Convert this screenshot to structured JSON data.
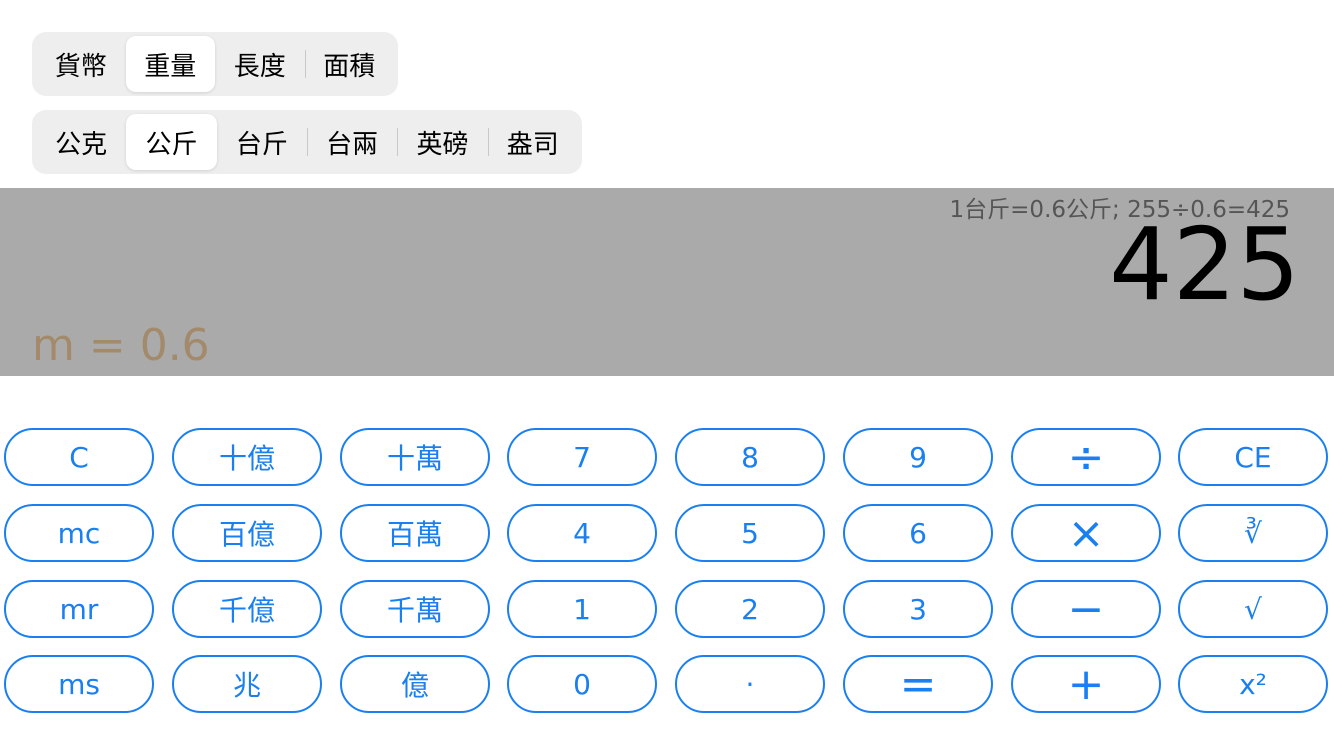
{
  "category_tabs": [
    {
      "label": "貨幣",
      "active": false
    },
    {
      "label": "重量",
      "active": true
    },
    {
      "label": "長度",
      "active": false
    },
    {
      "label": "面積",
      "active": false
    }
  ],
  "unit_tabs": [
    {
      "label": "公克",
      "active": false
    },
    {
      "label": "公斤",
      "active": true
    },
    {
      "label": "台斤",
      "active": false
    },
    {
      "label": "台兩",
      "active": false
    },
    {
      "label": "英磅",
      "active": false
    },
    {
      "label": "盎司",
      "active": false
    }
  ],
  "display": {
    "formula": "1台斤=0.6公斤; 255÷0.6=425",
    "result": "425",
    "memory": "m = 0.6"
  },
  "colors": {
    "accent": "#1a7ff0",
    "display_bg": "#aaaaaa",
    "memory_text": "#a38a6a"
  },
  "keys": [
    [
      "C",
      "十億",
      "十萬",
      "7",
      "8",
      "9",
      "÷",
      "CE"
    ],
    [
      "mc",
      "百億",
      "百萬",
      "4",
      "5",
      "6",
      "×",
      "∛"
    ],
    [
      "mr",
      "千億",
      "千萬",
      "1",
      "2",
      "3",
      "−",
      "√"
    ],
    [
      "ms",
      "兆",
      "億",
      "0",
      "·",
      "=",
      "+",
      "x²"
    ]
  ]
}
